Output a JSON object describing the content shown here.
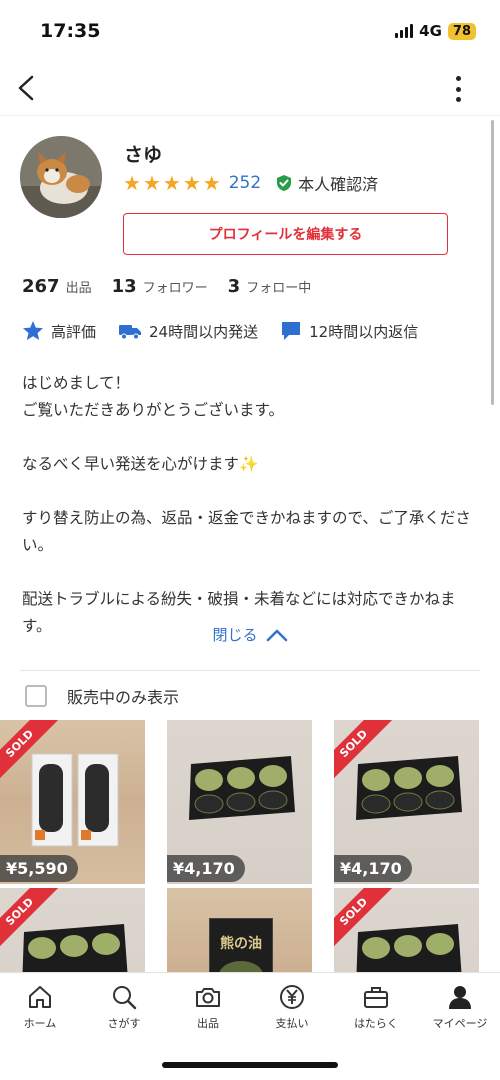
{
  "status": {
    "time": "17:35",
    "network": "4G",
    "battery": "78"
  },
  "profile": {
    "name": "さゆ",
    "rating_count": "252",
    "verified_label": "本人確認済",
    "edit_button": "プロフィールを編集する",
    "stars": 5
  },
  "stats": [
    {
      "num": "267",
      "label": "出品"
    },
    {
      "num": "13",
      "label": "フォロワー"
    },
    {
      "num": "3",
      "label": "フォロー中"
    }
  ],
  "badges": [
    {
      "icon": "star-icon",
      "label": "高評価"
    },
    {
      "icon": "truck-icon",
      "label": "24時間以内発送"
    },
    {
      "icon": "chat-icon",
      "label": "12時間以内返信"
    }
  ],
  "bio": "はじめまして！\nご覧いただきありがとうございます。\n\nなるべく早い発送を心がけます✨\n\nすり替え防止の為、返品・返金できかねますので、ご了承ください。\n\n配送トラブルによる紛失・破損・未着などには対応できかねます。",
  "close_label": "閉じる",
  "filter_label": "販売中のみ表示",
  "items": [
    {
      "price": "¥5,590",
      "sold": true,
      "sold_label": "SOLD"
    },
    {
      "price": "¥4,170",
      "sold": false
    },
    {
      "price": "¥4,170",
      "sold": true,
      "sold_label": "SOLD"
    },
    {
      "sold": true,
      "sold_label": "SOLD"
    },
    {
      "sold": false,
      "product_label": "熊の油"
    },
    {
      "sold": true,
      "sold_label": "SOLD"
    }
  ],
  "tabs": [
    {
      "label": "ホーム",
      "icon": "home-icon"
    },
    {
      "label": "さがす",
      "icon": "search-icon"
    },
    {
      "label": "出品",
      "icon": "camera-icon"
    },
    {
      "label": "支払い",
      "icon": "yen-icon"
    },
    {
      "label": "はたらく",
      "icon": "briefcase-icon"
    },
    {
      "label": "マイページ",
      "icon": "person-icon"
    }
  ],
  "colors": {
    "accent_red": "#e0303a",
    "link_blue": "#3572c9",
    "star": "#f5a623",
    "verified_green": "#2a9d4b"
  }
}
